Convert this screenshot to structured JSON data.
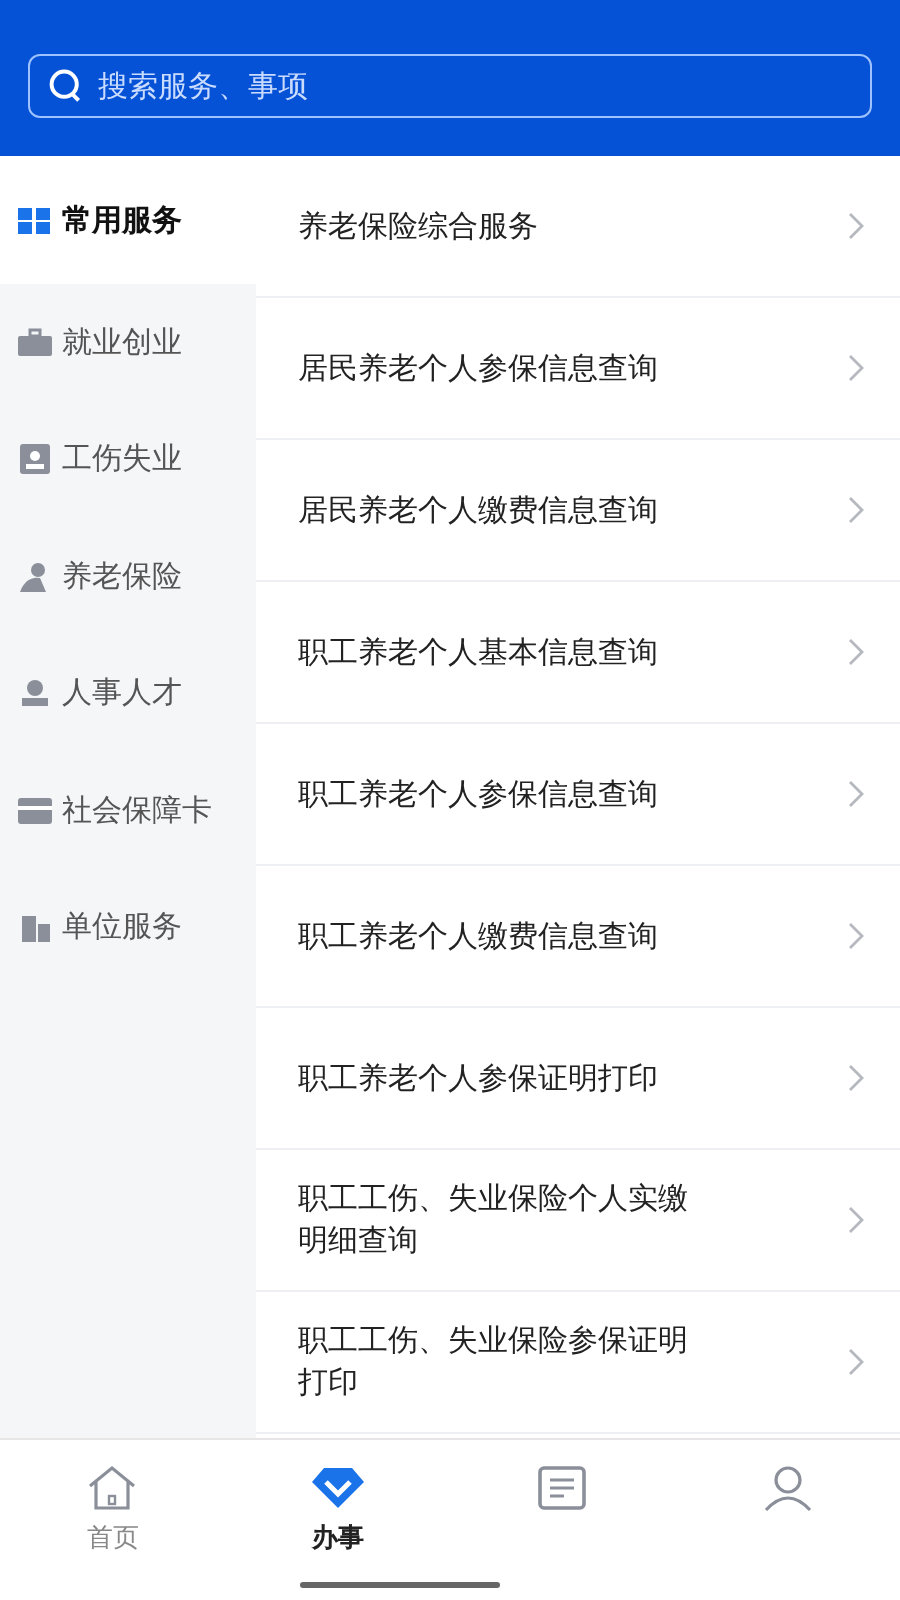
{
  "search": {
    "placeholder": "搜索服务、事项"
  },
  "sidebar": {
    "items": [
      {
        "label": "常用服务",
        "kind": "grid",
        "selected": true
      },
      {
        "label": "就业创业",
        "kind": "briefcase",
        "selected": false
      },
      {
        "label": "工伤失业",
        "kind": "badge",
        "selected": false
      },
      {
        "label": "养老保险",
        "kind": "person",
        "selected": false
      },
      {
        "label": "人事人才",
        "kind": "team",
        "selected": false
      },
      {
        "label": "社会保障卡",
        "kind": "card",
        "selected": false
      },
      {
        "label": "单位服务",
        "kind": "building",
        "selected": false
      }
    ]
  },
  "services": [
    {
      "label": "养老保险综合服务"
    },
    {
      "label": "居民养老个人参保信息查询"
    },
    {
      "label": "居民养老个人缴费信息查询"
    },
    {
      "label": "职工养老个人基本信息查询"
    },
    {
      "label": "职工养老个人参保信息查询"
    },
    {
      "label": "职工养老个人缴费信息查询"
    },
    {
      "label": "职工养老个人参保证明打印"
    },
    {
      "label": "职工工伤、失业保险个人实缴明细查询"
    },
    {
      "label": "职工工伤、失业保险参保证明打印"
    }
  ],
  "tab_bar": [
    {
      "label": "首页",
      "kind": "home",
      "selected": false
    },
    {
      "label": "办事",
      "kind": "diamond",
      "selected": true
    },
    {
      "kind": "list",
      "selected": false
    },
    {
      "kind": "user",
      "selected": false
    }
  ]
}
